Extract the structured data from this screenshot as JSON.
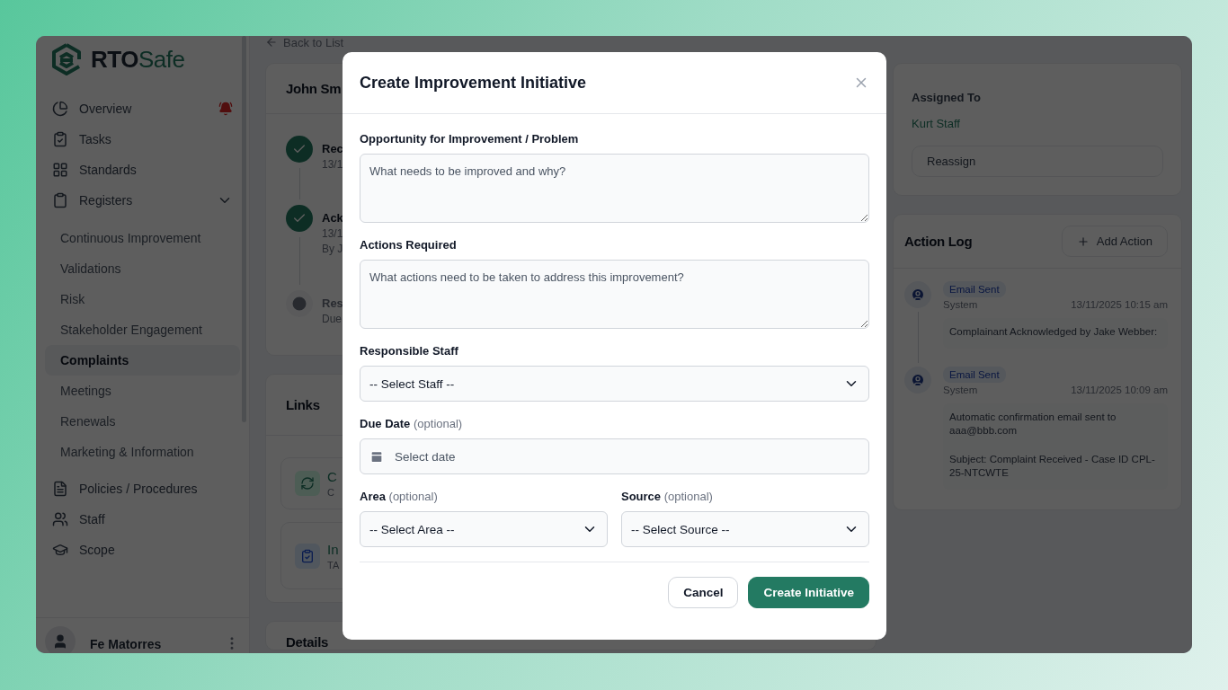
{
  "brand": {
    "parts": [
      "RTO",
      "Safe"
    ]
  },
  "sidebar": {
    "items": [
      {
        "label": "Overview",
        "selected": false,
        "alert": true
      },
      {
        "label": "Tasks",
        "selected": false
      },
      {
        "label": "Standards",
        "selected": false
      },
      {
        "label": "Registers",
        "selected": false,
        "expanded": true,
        "children": [
          {
            "label": "Continuous Improvement",
            "selected": false
          },
          {
            "label": "Validations",
            "selected": false
          },
          {
            "label": "Risk",
            "selected": false
          },
          {
            "label": "Stakeholder Engagement",
            "selected": false
          },
          {
            "label": "Complaints",
            "selected": true
          },
          {
            "label": "Meetings",
            "selected": false
          },
          {
            "label": "Renewals",
            "selected": false
          },
          {
            "label": "Marketing & Information",
            "selected": false
          }
        ]
      },
      {
        "label": "Policies / Procedures",
        "selected": false
      },
      {
        "label": "Staff",
        "selected": false
      },
      {
        "label": "Scope",
        "selected": false
      }
    ],
    "user": {
      "name": "Fe Matorres"
    }
  },
  "back_link": "Back to List",
  "complaint_card": {
    "title": "John Sm",
    "steps": [
      {
        "title": "Rec",
        "date": "13/1",
        "done": true
      },
      {
        "title": "Ack",
        "date": "13/1",
        "by": "By J",
        "done": true
      },
      {
        "title": "Res",
        "date": "Due",
        "done": false
      }
    ]
  },
  "links_card": {
    "title": "Links",
    "items": [
      {
        "kind": "improvement",
        "title": "C",
        "subtitle": "C"
      },
      {
        "kind": "task",
        "title": "In",
        "subtitle": "TA"
      }
    ]
  },
  "details_card": {
    "title": "Details"
  },
  "assigned_card": {
    "label": "Assigned To",
    "value": "Kurt Staff",
    "button": "Reassign"
  },
  "action_log": {
    "title": "Action Log",
    "add_button": "Add Action",
    "entries": [
      {
        "tag": "Email Sent",
        "author": "System",
        "time": "13/11/2025 10:15 am",
        "body": [
          "Complainant Acknowledged by Jake Webber:"
        ]
      },
      {
        "tag": "Email Sent",
        "author": "System",
        "time": "13/11/2025 10:09 am",
        "body": [
          "Automatic confirmation email sent to aaa@bbb.com",
          "Subject: Complaint Received - Case ID CPL-25-NTCWTE"
        ]
      }
    ]
  },
  "modal": {
    "title": "Create Improvement Initiative",
    "fields": [
      {
        "kind": "textarea",
        "label": "Opportunity for Improvement / Problem",
        "placeholder": "What needs to be improved and why?"
      },
      {
        "kind": "textarea",
        "label": "Actions Required",
        "placeholder": "What actions need to be taken to address this improvement?"
      },
      {
        "kind": "select",
        "label": "Responsible Staff",
        "value": "-- Select Staff --"
      },
      {
        "kind": "date",
        "label": "Due Date",
        "hint": "(optional)",
        "placeholder": "Select date"
      }
    ],
    "pair": [
      {
        "kind": "select",
        "label": "Area",
        "hint": "(optional)",
        "value": "-- Select Area --"
      },
      {
        "kind": "select",
        "label": "Source",
        "hint": "(optional)",
        "value": "-- Select Source --"
      }
    ],
    "buttons": [
      {
        "kind": "secondary",
        "label": "Cancel"
      },
      {
        "kind": "primary",
        "label": "Create Initiative"
      }
    ]
  }
}
